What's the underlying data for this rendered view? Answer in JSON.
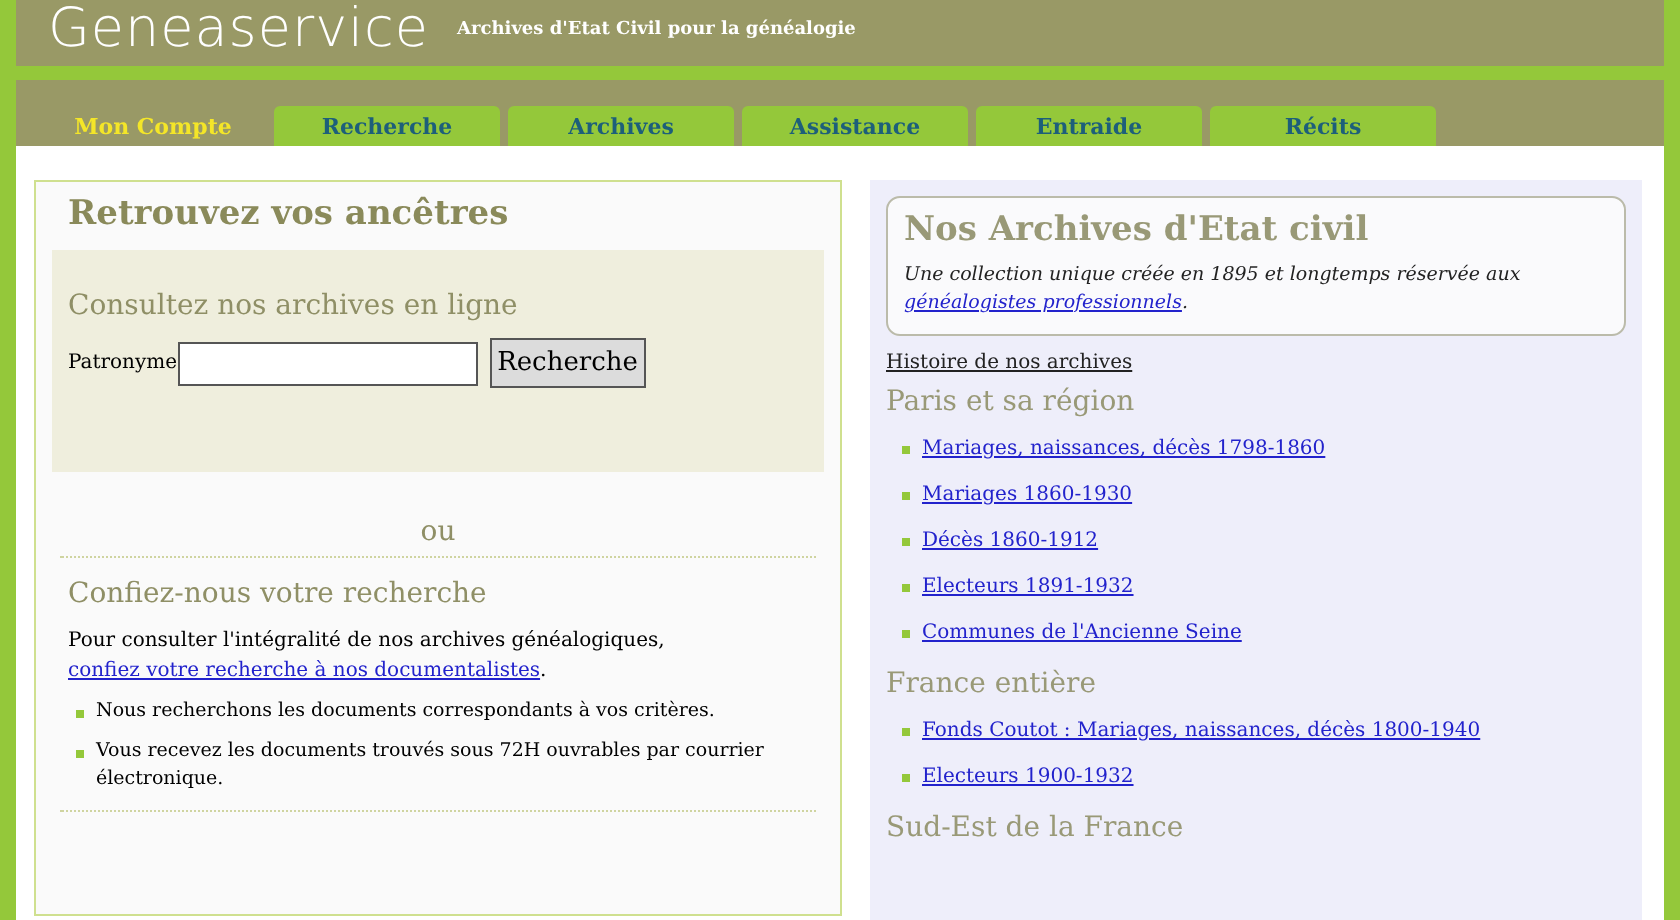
{
  "header": {
    "logo": "Geneaservice",
    "tagline": "Archives d'Etat Civil pour la généalogie"
  },
  "tabs": [
    {
      "label": "Mon Compte",
      "selected": true
    },
    {
      "label": "Recherche",
      "selected": false
    },
    {
      "label": "Archives",
      "selected": false
    },
    {
      "label": "Assistance",
      "selected": false
    },
    {
      "label": "Entraide",
      "selected": false
    },
    {
      "label": "Récits",
      "selected": false
    }
  ],
  "left_panel": {
    "title": "Retrouvez vos ancêtres",
    "search": {
      "heading": "Consultez nos archives en ligne",
      "label": "Patronyme",
      "button": "Recherche"
    },
    "separator": "ou",
    "section_title": "Confiez-nous votre recherche",
    "intro": "Pour consulter l'intégralité de nos archives généalogiques, ",
    "intro_link": "confiez votre recherche à nos documentalistes",
    "intro_end": ".",
    "bullets": [
      "Nous recherchons les documents correspondants à vos critères.",
      "Vous recevez les documents trouvés sous 72H ouvrables par courrier électronique."
    ]
  },
  "right_panel": {
    "title": "Nos Archives d'Etat civil",
    "subtitle": "Une collection unique créée en 1895 et longtemps réservée aux ",
    "subtitle_link": "généalogistes professionnels",
    "subtitle_end": ".",
    "history_link": "Histoire de nos archives",
    "sections": [
      {
        "title": "Paris et sa région",
        "links": [
          "Mariages, naissances, décès 1798-1860",
          "Mariages 1860-1930",
          "Décès 1860-1912",
          "Electeurs 1891-1932",
          "Communes de l'Ancienne Seine"
        ]
      },
      {
        "title": "France entière",
        "links": [
          "Fonds Coutot : Mariages, naissances, décès 1800-1940",
          "Electeurs 1900-1932"
        ]
      },
      {
        "title": "Sud-Est de la France"
      }
    ]
  }
}
